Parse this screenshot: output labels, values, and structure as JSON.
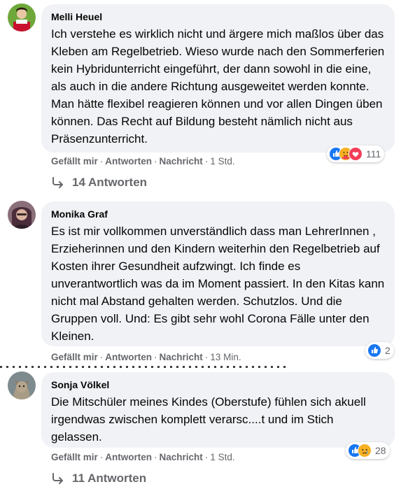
{
  "comments": [
    {
      "author": "Melli Heuel",
      "text": "Ich verstehe es wirklich nicht und ärgere mich maßlos über das Kleben am Regelbetrieb. Wieso wurde nach den Sommerferien kein Hybridunterricht eingeführt, der dann sowohl in die eine, als auch in die andere Richtung ausgeweitet werden konnte. Man hätte flexibel reagieren können und vor allen Dingen üben können. Das Recht auf Bildung besteht nämlich nicht aus Präsenzunterricht.",
      "like": "Gefällt mir",
      "reply": "Antworten",
      "message": "Nachricht",
      "time": "1 Std.",
      "reaction_icons": [
        "like-icon",
        "care-icon",
        "love-icon"
      ],
      "reaction_count": "111",
      "replies": "14 Antworten"
    },
    {
      "author": "Monika Graf",
      "text": "Es ist mir vollkommen unverständlich dass man LehrerInnen , Erzieherinnen und den Kindern weiterhin den Regelbetrieb auf Kosten ihrer Gesundheit aufzwingt. Ich finde es unverantwortlich was da im Moment passiert. In den Kitas kann nicht mal Abstand gehalten werden. Schutzlos. Und die Gruppen voll. Und: Es gibt sehr wohl Corona Fälle unter den Kleinen.",
      "like": "Gefällt mir",
      "reply": "Antworten",
      "message": "Nachricht",
      "time": "13 Min.",
      "reaction_icons": [
        "like-icon"
      ],
      "reaction_count": "2"
    },
    {
      "author": "Sonja Völkel",
      "text": "Die Mitschüler meines Kindes (Oberstufe) fühlen sich akuell irgendwas zwischen komplett verarsc....t und im Stich gelassen.",
      "like": "Gefällt mir",
      "reply": "Antworten",
      "message": "Nachricht",
      "time": "1 Std.",
      "reaction_icons": [
        "like-icon",
        "sad-icon"
      ],
      "reaction_count": "28",
      "replies": "11 Antworten"
    }
  ],
  "separator": "·",
  "colors": {
    "bubble": "#f0f2f5",
    "meta": "#65676b",
    "like": "#1877f2",
    "love": "#f33e58",
    "care": "#f7b125"
  }
}
